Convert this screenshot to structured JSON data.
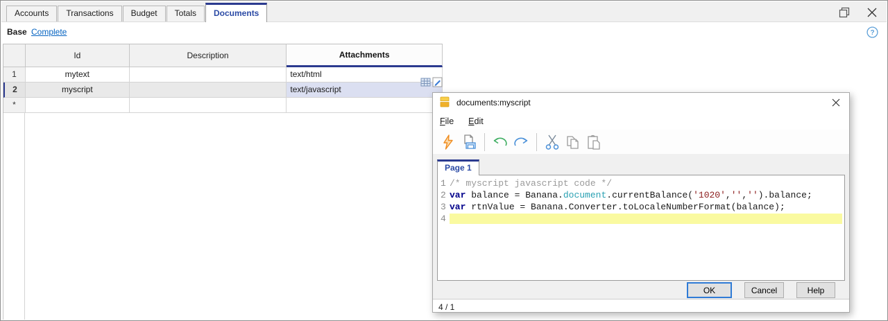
{
  "window": {
    "tabs": [
      {
        "label": "Accounts",
        "active": false
      },
      {
        "label": "Transactions",
        "active": false
      },
      {
        "label": "Budget",
        "active": false
      },
      {
        "label": "Totals",
        "active": false
      },
      {
        "label": "Documents",
        "active": true
      }
    ]
  },
  "viewbar": {
    "base": "Base",
    "complete": "Complete"
  },
  "table": {
    "columns": {
      "id": "Id",
      "description": "Description",
      "attachments": "Attachments"
    },
    "rows": [
      {
        "num": "1",
        "id": "mytext",
        "description": "",
        "attachments": "text/html"
      },
      {
        "num": "2",
        "id": "myscript",
        "description": "",
        "attachments": "text/javascript"
      },
      {
        "num": "*",
        "id": "",
        "description": "",
        "attachments": ""
      }
    ]
  },
  "dialog": {
    "title": "documents:myscript",
    "menu": [
      {
        "first": "F",
        "rest": "ile"
      },
      {
        "first": "E",
        "rest": "dit"
      }
    ],
    "toolbar_icons": [
      "run-script-icon",
      "print-icon",
      "undo-icon",
      "redo-icon",
      "cut-icon",
      "copy-icon",
      "paste-icon"
    ],
    "page_tab": "Page 1",
    "editor": {
      "lines": [
        {
          "num": "1",
          "tokens": [
            {
              "text": "/* myscript javascript code */",
              "style": "comment"
            }
          ]
        },
        {
          "num": "2",
          "tokens": [
            {
              "text": "var",
              "style": "kw"
            },
            {
              "text": " balance = Banana.",
              "style": "plain"
            },
            {
              "text": "document",
              "style": "type"
            },
            {
              "text": ".currentBalance(",
              "style": "plain"
            },
            {
              "text": "'1020'",
              "style": "str"
            },
            {
              "text": ",",
              "style": "plain"
            },
            {
              "text": "''",
              "style": "str"
            },
            {
              "text": ",",
              "style": "plain"
            },
            {
              "text": "''",
              "style": "str"
            },
            {
              "text": ").balance;",
              "style": "plain"
            }
          ]
        },
        {
          "num": "3",
          "tokens": [
            {
              "text": "var",
              "style": "kw"
            },
            {
              "text": " rtnValue = Banana.Converter.toLocaleNumberFormat(balance);",
              "style": "plain"
            }
          ]
        },
        {
          "num": "4",
          "tokens": []
        }
      ]
    },
    "buttons": {
      "ok": "OK",
      "cancel": "Cancel",
      "help": "Help"
    },
    "status": "4 / 1"
  },
  "colors": {
    "accent_navy": "#2b3a8f",
    "active_tab_text": "#2b4aa5",
    "link_blue": "#0563c1",
    "selected_cell": "#dbdff1",
    "current_line_yellow": "#fafaa0",
    "ok_button_border": "#2f7bd6",
    "lightning_orange": "#f59a23",
    "undo_green": "#3fae62",
    "redo_blue": "#4a90d9",
    "chrome_gray": "#f0f0f0"
  }
}
